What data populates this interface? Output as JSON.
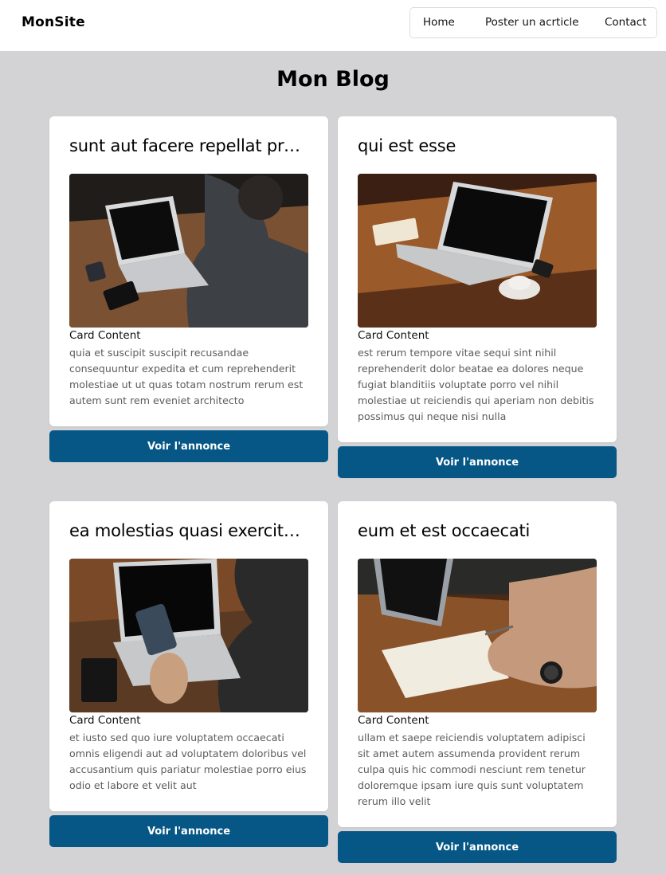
{
  "header": {
    "brand": "MonSite",
    "nav": [
      {
        "label": "Home"
      },
      {
        "label": "Poster un acrticle"
      },
      {
        "label": "Contact"
      }
    ]
  },
  "page_title": "Mon Blog",
  "cards": [
    {
      "title": "sunt aut facere repellat provident occaecati excepturi optio reprehenderit",
      "subtitle": "Card Content",
      "body": "quia et suscipit suscipit recusandae consequuntur expedita et cum reprehenderit molestiae ut ut quas totam nostrum rerum est autem sunt rem eveniet architecto",
      "button": "Voir l'annonce",
      "image_icon": "laptop-photo"
    },
    {
      "title": "qui est esse",
      "subtitle": "Card Content",
      "body": "est rerum tempore vitae sequi sint nihil reprehenderit dolor beatae ea dolores neque fugiat blanditiis voluptate porro vel nihil molestiae ut reiciendis qui aperiam non debitis possimus qui neque nisi nulla",
      "button": "Voir l'annonce",
      "image_icon": "laptop-photo"
    },
    {
      "title": "ea molestias quasi exercitationem repellat qui ipsa sit aut",
      "subtitle": "Card Content",
      "body": "et iusto sed quo iure voluptatem occaecati omnis eligendi aut ad voluptatem doloribus vel accusantium quis pariatur molestiae porro eius odio et labore et velit aut",
      "button": "Voir l'annonce",
      "image_icon": "laptop-photo"
    },
    {
      "title": "eum et est occaecati",
      "subtitle": "Card Content",
      "body": "ullam et saepe reiciendis voluptatem adipisci sit amet autem assumenda provident rerum culpa quis hic commodi nesciunt rem tenetur doloremque ipsam iure quis sunt voluptatem rerum illo velit",
      "button": "Voir l'annonce",
      "image_icon": "laptop-photo"
    }
  ],
  "colors": {
    "background": "#d3d3d6",
    "button": "#065785",
    "card": "#ffffff"
  }
}
